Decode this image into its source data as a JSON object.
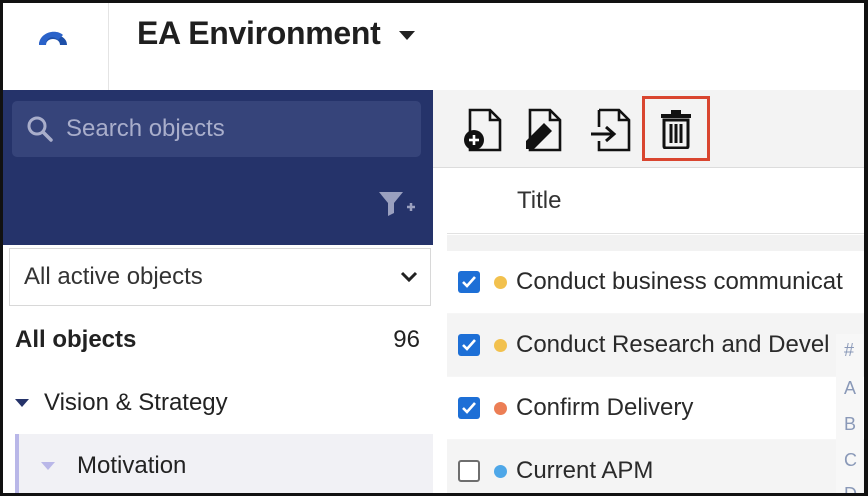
{
  "header": {
    "title": "EA Environment",
    "logo_icon": "arc-logo-icon",
    "dropdown_icon": "caret-down-icon"
  },
  "sidebar": {
    "search": {
      "placeholder": "Search objects",
      "value": "",
      "icon": "search-icon"
    },
    "filter_icon": "filter-add-icon",
    "scope_select": {
      "value": "All active objects",
      "icon": "chevron-down-icon"
    },
    "all_objects": {
      "label": "All objects",
      "count": "96"
    },
    "tree": [
      {
        "label": "Vision & Strategy",
        "expanded": true
      },
      {
        "label": "Motivation",
        "expanded": true,
        "selected": true
      }
    ]
  },
  "toolbar": {
    "buttons": [
      {
        "name": "new-object",
        "icon": "file-add-icon"
      },
      {
        "name": "edit-object",
        "icon": "file-edit-icon"
      },
      {
        "name": "move-object",
        "icon": "file-move-icon"
      },
      {
        "name": "delete-object",
        "icon": "trash-icon",
        "highlighted": true
      }
    ]
  },
  "table": {
    "column_title": "Title",
    "rows": [
      {
        "title": "Conduct business communicat",
        "checked": true,
        "dot_color": "#f2c14e"
      },
      {
        "title": "Conduct Research and Devel",
        "checked": true,
        "dot_color": "#f2c14e"
      },
      {
        "title": "Confirm Delivery",
        "checked": true,
        "dot_color": "#ec7e55"
      },
      {
        "title": "Current APM",
        "checked": false,
        "dot_color": "#4ea7e8"
      }
    ]
  },
  "alpha_index": [
    "#",
    "A",
    "B",
    "C",
    "D"
  ],
  "colors": {
    "sidebar_bg": "#25336a",
    "search_bg": "#36447a",
    "checkbox_blue": "#1d6fd6",
    "highlight_red": "#d9452f",
    "tree_accent": "#b9b7e8"
  }
}
